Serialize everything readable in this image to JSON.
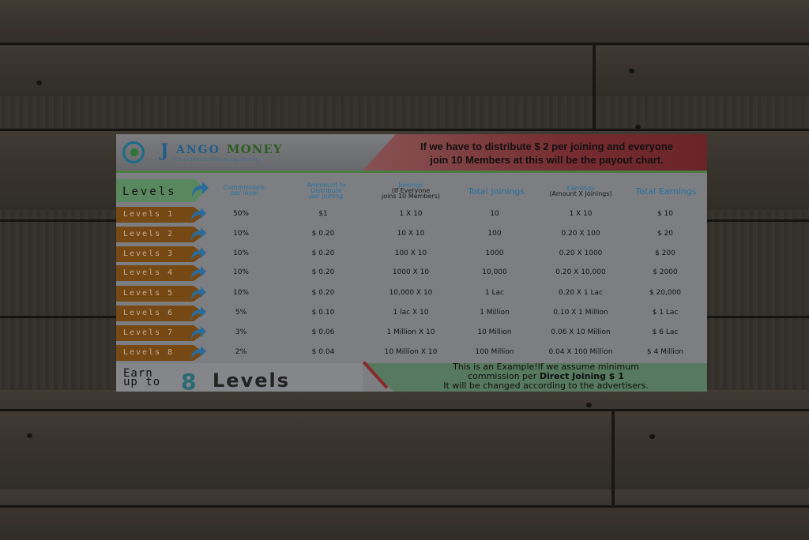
{
  "logo": {
    "letter": "J",
    "word1": "ANGO",
    "word2": "MONEY",
    "tagline": "Earn Dollars With Jango Money"
  },
  "header": {
    "line1": "If we have to distribute $ 2 per joining and everyone",
    "line2": "join 10 Members at this will be the payout chart."
  },
  "columns": {
    "levels": "Levels",
    "commission": [
      "Commissions",
      "per level"
    ],
    "amount": [
      "Ammount to",
      "Distribute",
      "per joining"
    ],
    "joinings": [
      "Joinings",
      "(If Everyone",
      "joins 10 Members)"
    ],
    "total_joinings": "Total Joinings",
    "earnings": [
      "Earnings",
      "(Amount X Joinings)"
    ],
    "total_earnings": "Total Earnings"
  },
  "rows": [
    {
      "level": "Levels 1",
      "commission": "50%",
      "amount": "$1",
      "joinings": "1 X 10",
      "total": "10",
      "earnings": "1 X 10",
      "total_earnings": "$ 10"
    },
    {
      "level": "Levels 2",
      "commission": "10%",
      "amount": "$ 0.20",
      "joinings": "10 X 10",
      "total": "100",
      "earnings": "0.20 X 100",
      "total_earnings": "$ 20"
    },
    {
      "level": "Levels 3",
      "commission": "10%",
      "amount": "$ 0.20",
      "joinings": "100 X 10",
      "total": "1000",
      "earnings": "0.20 X 1000",
      "total_earnings": "$ 200"
    },
    {
      "level": "Levels 4",
      "commission": "10%",
      "amount": "$ 0.20",
      "joinings": "1000 X 10",
      "total": "10,000",
      "earnings": "0.20 X 10,000",
      "total_earnings": "$ 2000"
    },
    {
      "level": "Levels 5",
      "commission": "10%",
      "amount": "$ 0.20",
      "joinings": "10,000 X 10",
      "total": "1 Lac",
      "earnings": "0.20 X 1 Lac",
      "total_earnings": "$ 20,000"
    },
    {
      "level": "Levels 6",
      "commission": "5%",
      "amount": "$ 0.10",
      "joinings": "1 lac X 10",
      "total": "1 Million",
      "earnings": "0.10 X 1 Million",
      "total_earnings": "$ 1 Lac"
    },
    {
      "level": "Levels 7",
      "commission": "3%",
      "amount": "$ 0.06",
      "joinings": "1 Million X 10",
      "total": "10 Million",
      "earnings": "0.06 X 10 Million",
      "total_earnings": "$ 6 Lac"
    },
    {
      "level": "Levels 8",
      "commission": "2%",
      "amount": "$ 0.04",
      "joinings": "10 Million X 10",
      "total": "100 Million",
      "earnings": "0.04 X 100 Million",
      "total_earnings": "$ 4 Million"
    }
  ],
  "footer": {
    "earn_line1": "Earn",
    "earn_line2": "up to",
    "big_number": "8",
    "big_word": "Levels",
    "note_line1": "This is an Example!If we assume minimum",
    "note_line2_pre": "commission per ",
    "note_line2_bold": "Direct Joining $ 1",
    "note_line3": "It will be changed according to the advertisers."
  },
  "colors": {
    "header_red": "#7a2d31",
    "green": "#5c8d62",
    "level_orange": "#7a4a14",
    "column_blue": "#2575a8",
    "arrow_blue": "#2a6fa0"
  }
}
